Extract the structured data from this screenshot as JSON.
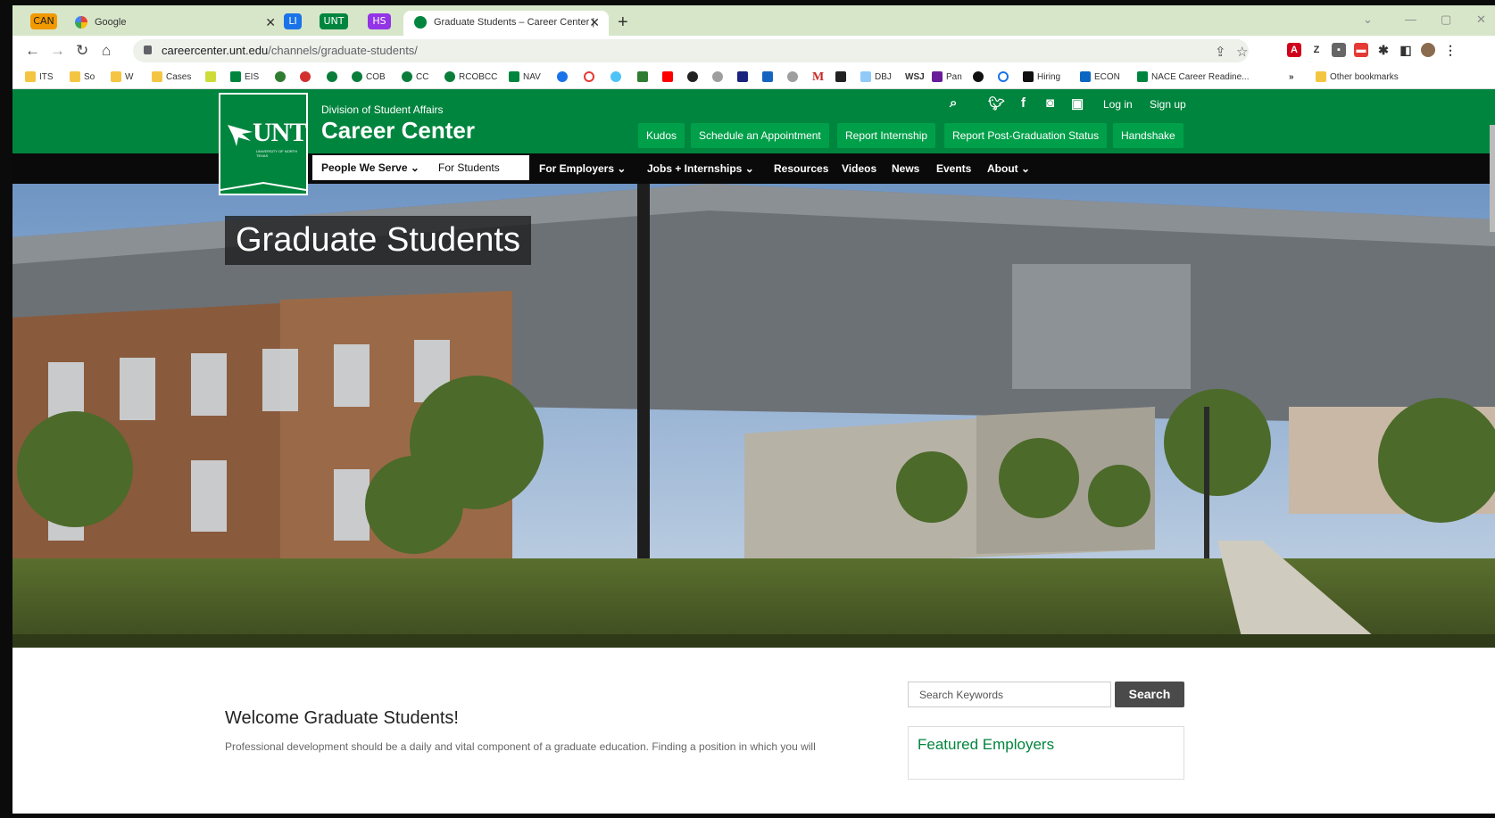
{
  "browser": {
    "tab_chips": [
      {
        "label": "CAN",
        "color": "#f29900"
      },
      {
        "label": "LI",
        "color": "#1a73e8"
      },
      {
        "label": "UNT",
        "color": "#00853e"
      },
      {
        "label": "HS",
        "color": "#9334e6"
      }
    ],
    "tabs": [
      {
        "title": "Google"
      },
      {
        "title": "Graduate Students – Career Center |"
      }
    ],
    "new_tab": "+",
    "url_host": "careercenter.unt.edu",
    "url_path": "/channels/graduate-students/",
    "bookmarks": [
      "ITS",
      "So",
      "W",
      "Cases",
      "EIS",
      "COB",
      "CC",
      "RCOBCC",
      "NAV",
      "M",
      "DBJ",
      "WSJ",
      "Pan",
      "Hiring",
      "ECON",
      "NACE Career Readine...",
      "»",
      "Other bookmarks"
    ]
  },
  "site": {
    "logo_text": "UNT",
    "logo_sub": "UNIVERSITY OF NORTH TEXAS",
    "division": "Division of Student Affairs",
    "title": "Career Center",
    "util": {
      "login": "Log in",
      "signup": "Sign up"
    },
    "actions": [
      "Kudos",
      "Schedule an Appointment",
      "Report Internship",
      "Report Post-Graduation Status",
      "Handshake"
    ],
    "nav": {
      "people": "People We Serve",
      "students": "For Students",
      "employers": "For Employers",
      "jobs": "Jobs + Internships",
      "resources": "Resources",
      "videos": "Videos",
      "news": "News",
      "events": "Events",
      "about": "About"
    },
    "brand_color": "#00853e"
  },
  "hero": {
    "title": "Graduate Students"
  },
  "content": {
    "welcome": "Welcome Graduate Students!",
    "intro": "Professional development should be a daily and vital component of a graduate education. Finding a position in which you will",
    "search_placeholder": "Search Keywords",
    "search_button": "Search",
    "featured_title": "Featured Employers"
  }
}
